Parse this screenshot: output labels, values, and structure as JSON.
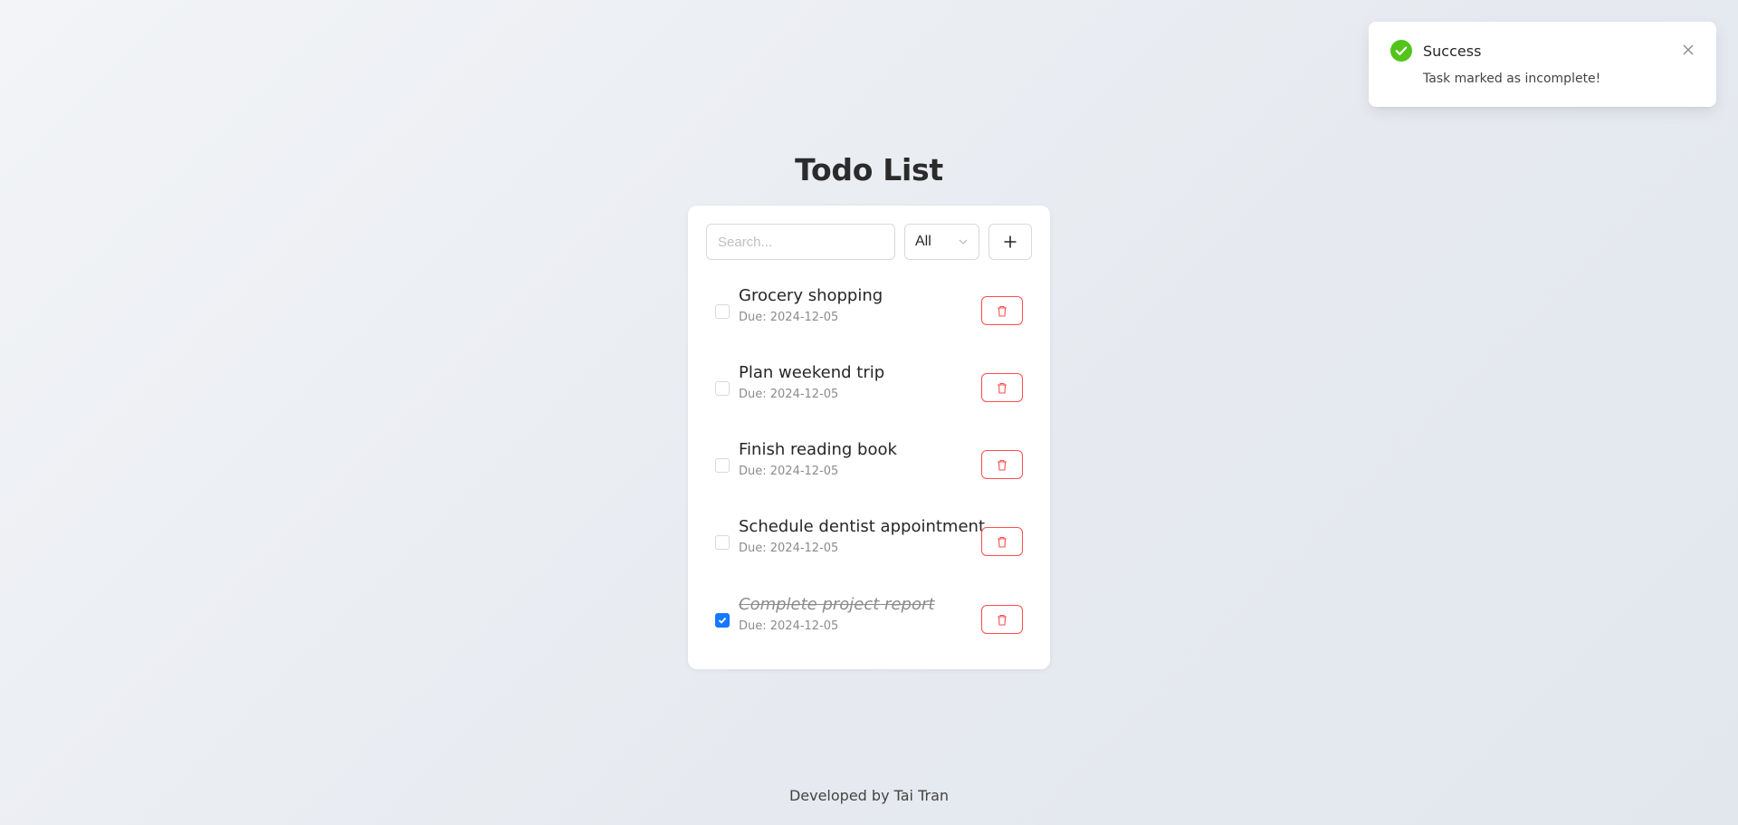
{
  "app": {
    "title": "Todo List"
  },
  "toolbar": {
    "search_placeholder": "Search...",
    "filter_value": "All",
    "add_icon": "plus-icon"
  },
  "todos": [
    {
      "title": "Grocery shopping",
      "due": "Due: 2024-12-05",
      "completed": false
    },
    {
      "title": "Plan weekend trip",
      "due": "Due: 2024-12-05",
      "completed": false
    },
    {
      "title": "Finish reading book",
      "due": "Due: 2024-12-05",
      "completed": false
    },
    {
      "title": "Schedule dentist appointment",
      "due": "Due: 2024-12-05",
      "completed": false
    },
    {
      "title": "Complete project report",
      "due": "Due: 2024-12-05",
      "completed": true
    }
  ],
  "notification": {
    "title": "Success",
    "message": "Task marked as incomplete!",
    "icon": "check-circle-icon",
    "color": "#52c41a"
  },
  "footer": {
    "text": "Developed by Tai Tran"
  },
  "colors": {
    "primary": "#1677ff",
    "danger": "#ff4d4f",
    "success": "#52c41a"
  }
}
